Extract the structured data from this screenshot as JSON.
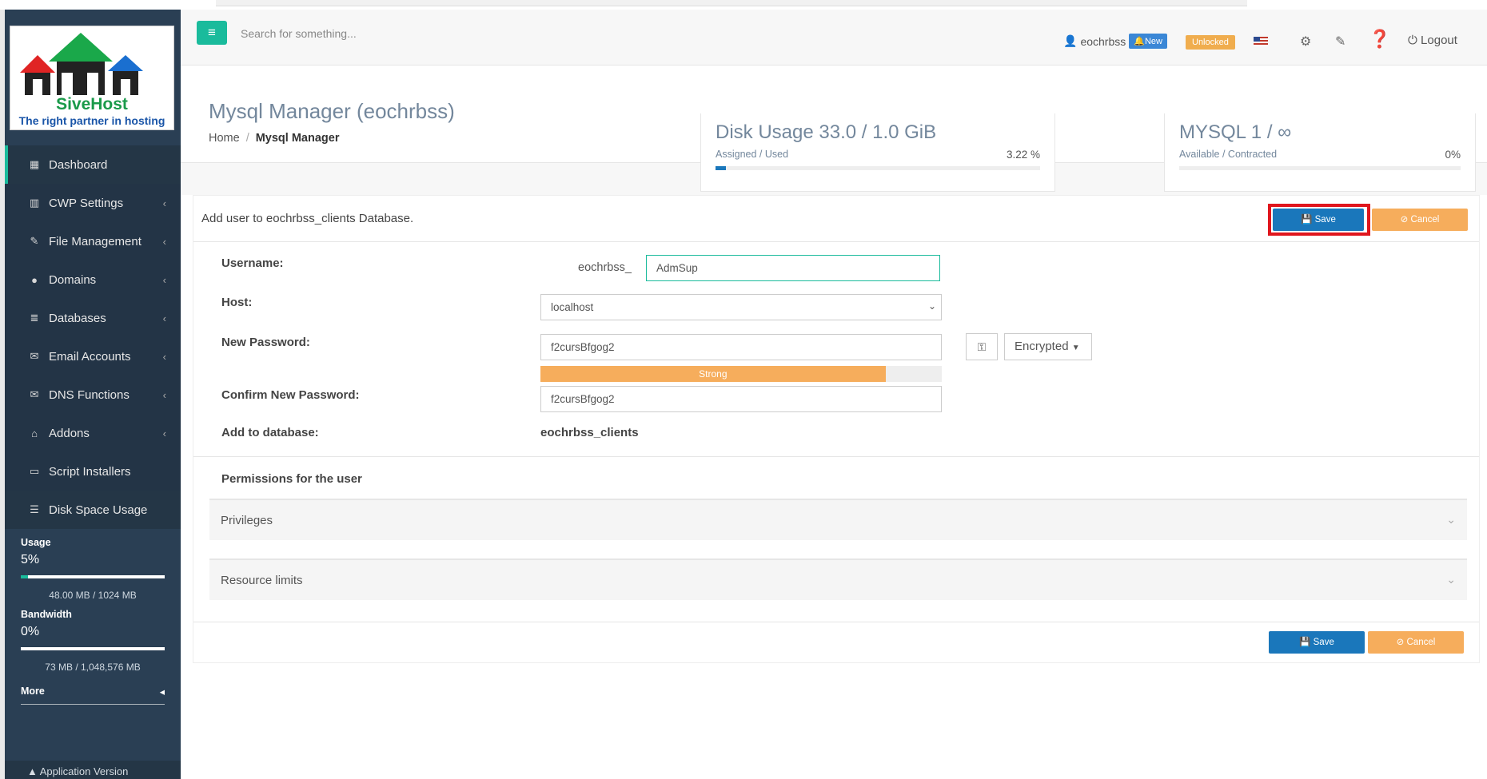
{
  "search": {
    "placeholder": "Search for something..."
  },
  "logo": {
    "brand": "SiveHost",
    "tagline": "The right partner in hosting"
  },
  "sidebar": {
    "items": [
      {
        "label": "Dashboard",
        "icon": "grid-icon"
      },
      {
        "label": "CWP Settings",
        "icon": "chart-icon"
      },
      {
        "label": "File Management",
        "icon": "edit-icon"
      },
      {
        "label": "Domains",
        "icon": "globe-icon"
      },
      {
        "label": "Databases",
        "icon": "database-icon"
      },
      {
        "label": "Email Accounts",
        "icon": "envelope-icon"
      },
      {
        "label": "DNS Functions",
        "icon": "envelope-icon"
      },
      {
        "label": "Addons",
        "icon": "bank-icon"
      },
      {
        "label": "Script Installers",
        "icon": "monitor-icon"
      },
      {
        "label": "Disk Space Usage",
        "icon": "list-icon"
      }
    ],
    "usage_label": "Usage",
    "usage_pct": "5%",
    "usage_fraction": 0.05,
    "usage_sub": "48.00 MB / 1024 MB",
    "bandwidth_label": "Bandwidth",
    "bandwidth_pct": "0%",
    "bandwidth_fraction": 0.0,
    "bandwidth_sub": "73 MB / 1,048,576 MB",
    "more_label": "More",
    "app_version": "Application Version"
  },
  "topnav": {
    "username": "eochrbss",
    "new_badge": "New",
    "unlocked_badge": "Unlocked",
    "logout": "Logout"
  },
  "page": {
    "title": "Mysql Manager (eochrbss)",
    "breadcrumb_home": "Home",
    "breadcrumb_current": "Mysql Manager"
  },
  "stats": {
    "disk_title": "Disk Usage 33.0 / 1.0 GiB",
    "disk_sub": "Assigned / Used",
    "disk_pct": "3.22 %",
    "disk_fraction": 0.0322,
    "mysql_title": "MYSQL 1 / ∞",
    "mysql_sub": "Available / Contracted",
    "mysql_pct": "0%"
  },
  "form": {
    "heading": "Add user to eochrbss_clients Database.",
    "save_label": "Save",
    "cancel_label": "Cancel",
    "username_label": "Username:",
    "username_prefix": "eochrbss_",
    "username_value": "AdmSup",
    "host_label": "Host:",
    "host_value": "localhost",
    "password_label": "New Password:",
    "password_value": "f2cursBfgog2",
    "strength_label": "Strong",
    "strength_fraction": 0.86,
    "encrypted_label": "Encrypted",
    "confirm_label": "Confirm New Password:",
    "confirm_value": "f2cursBfgog2",
    "adddb_label": "Add to database:",
    "adddb_value": "eochrbss_clients",
    "permissions_label": "Permissions for the user",
    "privileges_label": "Privileges",
    "resource_label": "Resource limits"
  },
  "colors": {
    "sidebar": "#2a3f54",
    "accent": "#1abb9c",
    "save": "#1a77bb",
    "cancel": "#f6ad5c",
    "highlight": "#e0161d"
  }
}
